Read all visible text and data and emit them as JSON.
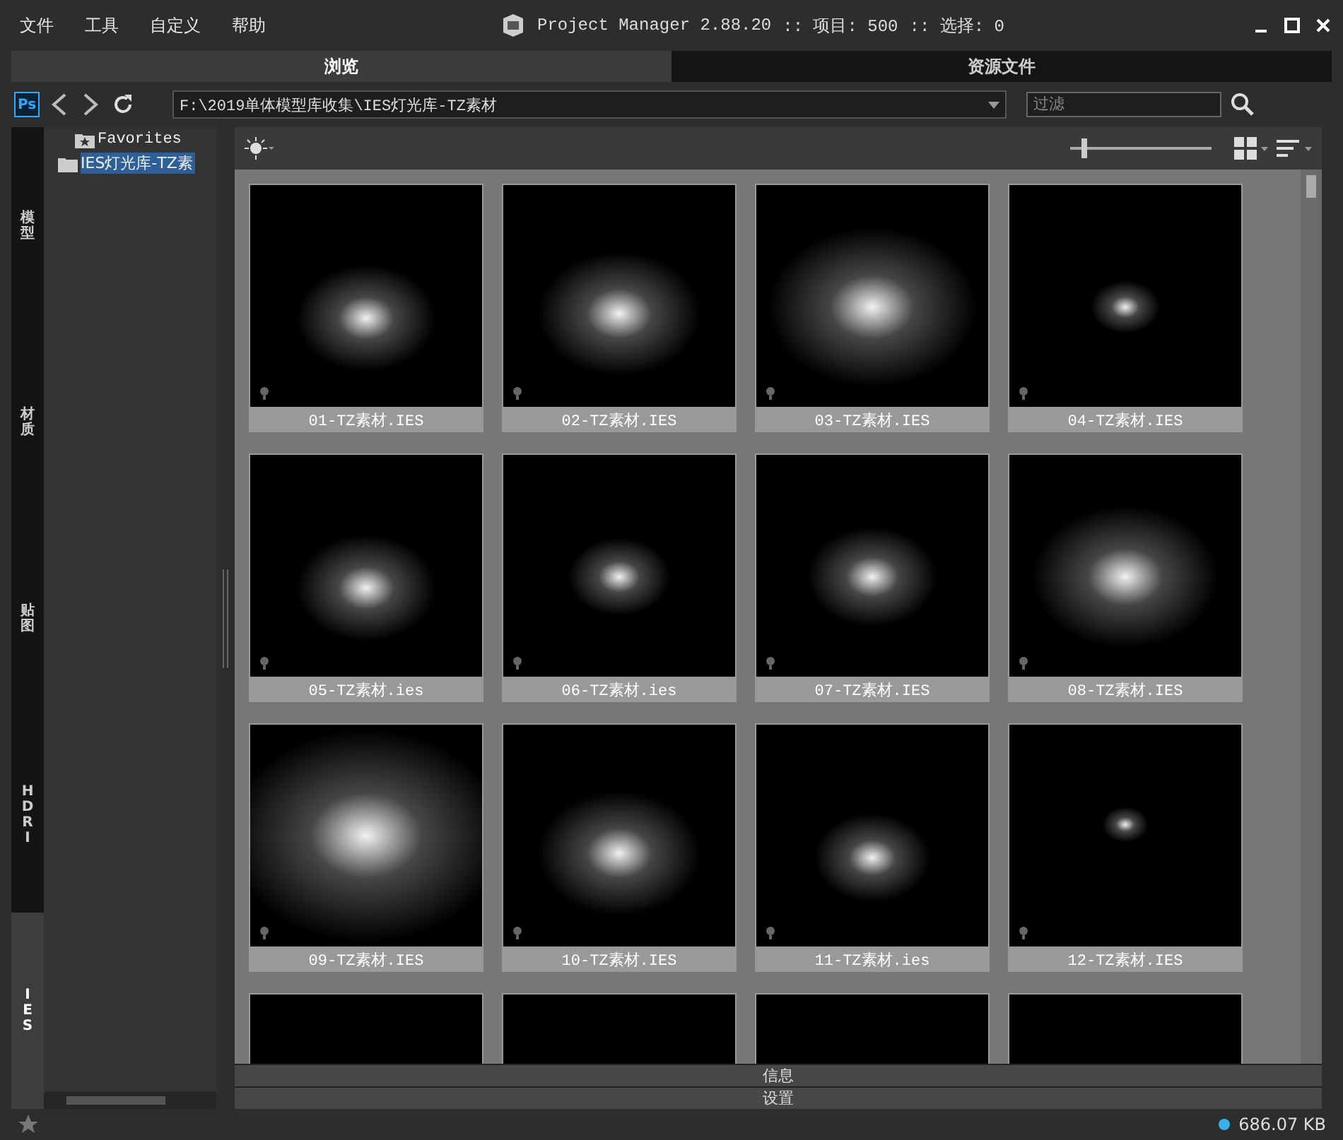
{
  "menu": [
    "文件",
    "工具",
    "自定义",
    "帮助"
  ],
  "window": {
    "title": "Project Manager 2.88.20",
    "items_label": ":: 项目: 500",
    "selection_label": ":: 选择: 0"
  },
  "tabs": [
    {
      "label": "浏览",
      "selected": true
    },
    {
      "label": "资源文件",
      "selected": false
    }
  ],
  "path": {
    "value": "F:\\2019单体模型库收集\\IES灯光库-TZ素材"
  },
  "filter": {
    "placeholder": "过滤"
  },
  "categories": [
    {
      "label": "模型",
      "selected": false
    },
    {
      "label": "材质",
      "selected": false
    },
    {
      "label": "贴图",
      "selected": false
    },
    {
      "label": "HDRI",
      "selected": false
    },
    {
      "label": "IES",
      "selected": true
    }
  ],
  "tree": [
    {
      "label": "Favorites",
      "kind": "favorites",
      "selected": false
    },
    {
      "label": "IES灯光库-TZ素",
      "kind": "folder",
      "selected": true
    }
  ],
  "zoom_slider": {
    "level": 0.1
  },
  "thumbnails": [
    {
      "label": "01-TZ素材.IES"
    },
    {
      "label": "02-TZ素材.IES"
    },
    {
      "label": "03-TZ素材.IES"
    },
    {
      "label": "04-TZ素材.IES"
    },
    {
      "label": "05-TZ素材.ies"
    },
    {
      "label": "06-TZ素材.ies"
    },
    {
      "label": "07-TZ素材.IES"
    },
    {
      "label": "08-TZ素材.IES"
    },
    {
      "label": "09-TZ素材.IES"
    },
    {
      "label": "10-TZ素材.IES"
    },
    {
      "label": "11-TZ素材.ies"
    },
    {
      "label": "12-TZ素材.IES"
    }
  ],
  "partial_row_visible": true,
  "photoshop_button": {
    "label": "Ps"
  },
  "panels": [
    "信息",
    "设置"
  ],
  "status": {
    "size": "686.07 KB"
  }
}
